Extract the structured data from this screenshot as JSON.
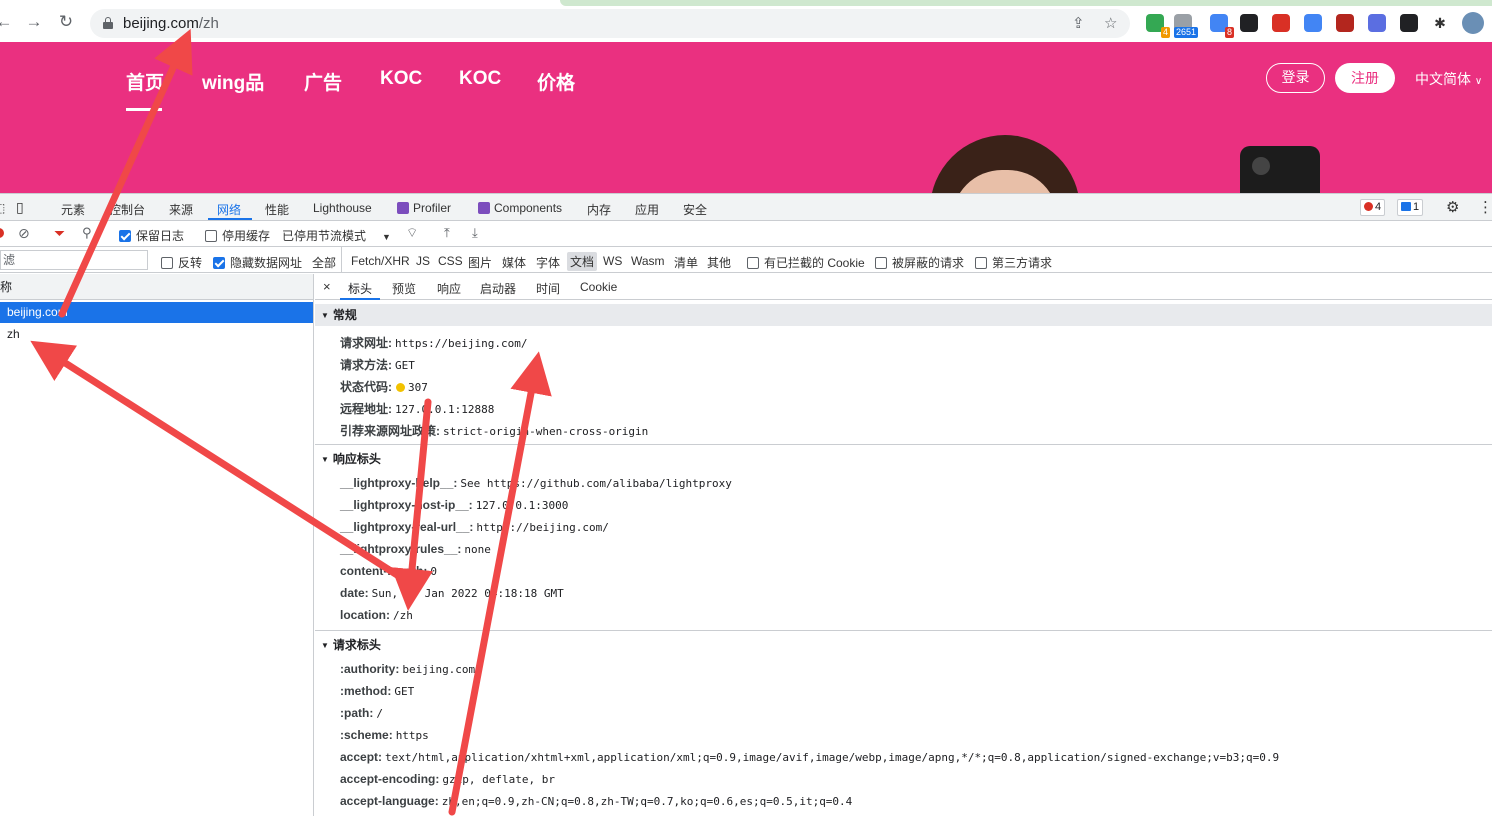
{
  "browser": {
    "url_host": "beijing.com",
    "url_path": "/zh",
    "extensions": [
      {
        "name": "ext-green",
        "color": "#34a853",
        "badge": "4",
        "badge_color": "#f29900"
      },
      {
        "name": "ext-counter",
        "color": "#9aa0a6",
        "badge": "2651",
        "badge_color": "#1a73e8"
      },
      {
        "name": "ext-grid",
        "color": "#4285f4",
        "badge": "8",
        "badge_color": "#d93025"
      },
      {
        "name": "ext-mask",
        "color": "#202124",
        "badge": "",
        "badge_color": ""
      },
      {
        "name": "ext-fe",
        "color": "#d93025",
        "badge": "",
        "badge_color": ""
      },
      {
        "name": "ext-compass",
        "color": "#4285f4",
        "badge": "",
        "badge_color": ""
      },
      {
        "name": "ext-red",
        "color": "#b3261e",
        "badge": "",
        "badge_color": ""
      },
      {
        "name": "ext-jh",
        "color": "#5b6ee1",
        "badge": "",
        "badge_color": ""
      },
      {
        "name": "ext-glasses",
        "color": "#202124",
        "badge": "",
        "badge_color": ""
      }
    ]
  },
  "site": {
    "nav": [
      "首页",
      "wing品",
      "广告",
      "KOC",
      "KOC",
      "价格"
    ],
    "login": "登录",
    "register": "注册",
    "language": "中文简体",
    "brand_color": "#ea3080"
  },
  "devtools": {
    "tabs": [
      "元素",
      "控制台",
      "来源",
      "网络",
      "性能",
      "Lighthouse",
      "Profiler",
      "Components",
      "内存",
      "应用",
      "安全"
    ],
    "active_tab": "网络",
    "error_count": "4",
    "message_count": "1",
    "toolbar": {
      "preserve_log": "保留日志",
      "disable_cache": "停用缓存",
      "throttling": "已停用节流模式"
    },
    "filter": {
      "placeholder": "滤",
      "invert": "反转",
      "hide_data_urls": "隐藏数据网址",
      "types": [
        "全部",
        "Fetch/XHR",
        "JS",
        "CSS",
        "图片",
        "媒体",
        "字体",
        "文档",
        "WS",
        "Wasm",
        "清单",
        "其他"
      ],
      "selected_type": "文档",
      "blocked_cookies": "有已拦截的 Cookie",
      "blocked_requests": "被屏蔽的请求",
      "third_party": "第三方请求"
    },
    "list": {
      "header": "称",
      "items": [
        "beijing.com",
        "zh"
      ]
    },
    "detail_tabs": [
      "标头",
      "预览",
      "响应",
      "启动器",
      "时间",
      "Cookie"
    ],
    "general": {
      "title": "常规",
      "rows": [
        {
          "k": "请求网址:",
          "v": "https://beijing.com/"
        },
        {
          "k": "请求方法:",
          "v": "GET"
        },
        {
          "k": "状态代码:",
          "v": "307"
        },
        {
          "k": "远程地址:",
          "v": "127.0.0.1:12888"
        },
        {
          "k": "引荐来源网址政策:",
          "v": "strict-origin-when-cross-origin"
        }
      ]
    },
    "response_headers": {
      "title": "响应标头",
      "rows": [
        {
          "k": "__lightproxy-help__:",
          "v": "See https://github.com/alibaba/lightproxy"
        },
        {
          "k": "__lightproxy-host-ip__:",
          "v": "127.0.0.1:3000"
        },
        {
          "k": "__lightproxy-real-url__:",
          "v": "https://beijing.com/"
        },
        {
          "k": "__lightproxy-rules__:",
          "v": "none"
        },
        {
          "k": "content-length:",
          "v": "0"
        },
        {
          "k": "date:",
          "v": "Sun, 09 Jan 2022 04:18:18 GMT"
        },
        {
          "k": "location:",
          "v": "/zh"
        }
      ]
    },
    "request_headers": {
      "title": "请求标头",
      "rows": [
        {
          "k": ":authority:",
          "v": "beijing.com"
        },
        {
          "k": ":method:",
          "v": "GET"
        },
        {
          "k": ":path:",
          "v": "/"
        },
        {
          "k": ":scheme:",
          "v": "https"
        },
        {
          "k": "accept:",
          "v": "text/html,application/xhtml+xml,application/xml;q=0.9,image/avif,image/webp,image/apng,*/*;q=0.8,application/signed-exchange;v=b3;q=0.9"
        },
        {
          "k": "accept-encoding:",
          "v": "gzip, deflate, br"
        },
        {
          "k": "accept-language:",
          "v": "zh,en;q=0.9,zh-CN;q=0.8,zh-TW;q=0.7,ko;q=0.6,es;q=0.5,it;q=0.4"
        }
      ]
    }
  }
}
